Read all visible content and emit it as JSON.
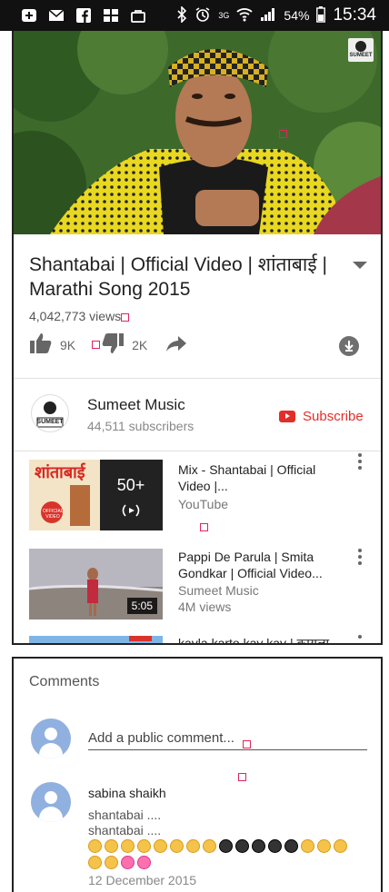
{
  "statusbar": {
    "battery": "54%",
    "time": "15:34",
    "network": "3G"
  },
  "video": {
    "watermark": "SUMEET"
  },
  "info": {
    "title": "Shantabai | Official Video | शांताबाई | Marathi Song 2015",
    "views": "4,042,773 views",
    "likes": "9K",
    "dislikes": "2K"
  },
  "channel": {
    "name": "Sumeet Music",
    "subscribers": "44,511 subscribers",
    "logo_text": "SUMEET",
    "subscribe_label": "Subscribe"
  },
  "related": [
    {
      "title": "Mix - Shantabai | Official Video |...",
      "sub1": "YouTube",
      "sub2": "",
      "badge": "50+",
      "thumb_text": "शांताबाई",
      "thumb_tag": "OFFICIAL VIDEO"
    },
    {
      "title": "Pappi De Parula | Smita Gondkar | Official Video...",
      "sub1": "Sumeet Music",
      "sub2": "4M views",
      "duration": "5:05"
    },
    {
      "title": "kayla karto kay kay | कायला"
    }
  ],
  "comments": {
    "heading": "Comments",
    "placeholder": "Add a public comment...",
    "items": [
      {
        "author": "sabina shaikh",
        "text": "shantabai ....\nshantabai ....",
        "date": "12 December 2015"
      }
    ]
  },
  "colors": {
    "accent": "#e52d27",
    "avatar": "#90b0e0"
  }
}
